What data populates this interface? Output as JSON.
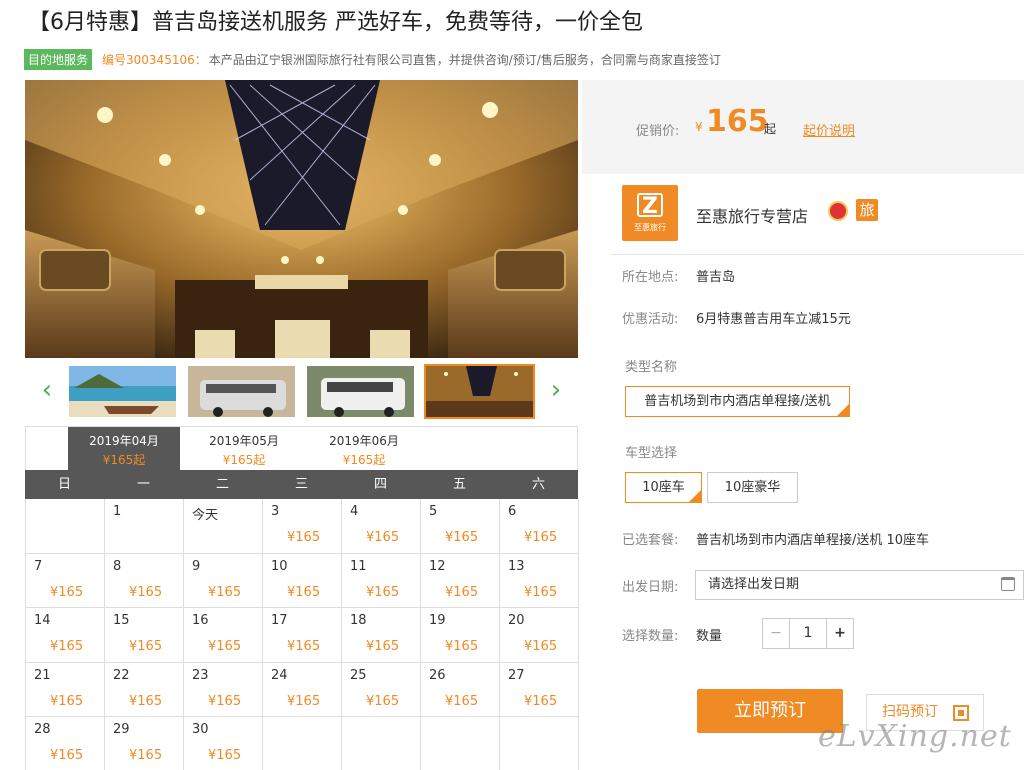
{
  "title": "【6月特惠】普吉岛接送机服务 严选好车，免费等待，一价全包",
  "meta": {
    "tag": "目的地服务",
    "code": "编号300345106：",
    "desc": "本产品由辽宁银洲国际旅行社有限公司直售，并提供咨询/预订/售后服务，合同需与商家直接签订"
  },
  "gallery": {
    "prev_icon": "chevron-left-icon",
    "next_icon": "chevron-right-icon",
    "active_thumb": 3
  },
  "months": [
    {
      "name": "2019年04月",
      "price": "¥165起"
    },
    {
      "name": "2019年05月",
      "price": "¥165起"
    },
    {
      "name": "2019年06月",
      "price": "¥165起"
    }
  ],
  "weekdays": [
    "日",
    "一",
    "二",
    "三",
    "四",
    "五",
    "六"
  ],
  "calendar": [
    {
      "d": "",
      "p": ""
    },
    {
      "d": "1",
      "p": ""
    },
    {
      "d": "今天",
      "p": ""
    },
    {
      "d": "3",
      "p": "¥165"
    },
    {
      "d": "4",
      "p": "¥165"
    },
    {
      "d": "5",
      "p": "¥165"
    },
    {
      "d": "6",
      "p": "¥165"
    },
    {
      "d": "7",
      "p": "¥165"
    },
    {
      "d": "8",
      "p": "¥165"
    },
    {
      "d": "9",
      "p": "¥165"
    },
    {
      "d": "10",
      "p": "¥165"
    },
    {
      "d": "11",
      "p": "¥165"
    },
    {
      "d": "12",
      "p": "¥165"
    },
    {
      "d": "13",
      "p": "¥165"
    },
    {
      "d": "14",
      "p": "¥165"
    },
    {
      "d": "15",
      "p": "¥165"
    },
    {
      "d": "16",
      "p": "¥165"
    },
    {
      "d": "17",
      "p": "¥165"
    },
    {
      "d": "18",
      "p": "¥165"
    },
    {
      "d": "19",
      "p": "¥165"
    },
    {
      "d": "20",
      "p": "¥165"
    },
    {
      "d": "21",
      "p": "¥165"
    },
    {
      "d": "22",
      "p": "¥165"
    },
    {
      "d": "23",
      "p": "¥165"
    },
    {
      "d": "24",
      "p": "¥165"
    },
    {
      "d": "25",
      "p": "¥165"
    },
    {
      "d": "26",
      "p": "¥165"
    },
    {
      "d": "27",
      "p": "¥165"
    },
    {
      "d": "28",
      "p": "¥165"
    },
    {
      "d": "29",
      "p": "¥165"
    },
    {
      "d": "30",
      "p": "¥165"
    },
    {
      "d": "",
      "p": ""
    },
    {
      "d": "",
      "p": ""
    },
    {
      "d": "",
      "p": ""
    },
    {
      "d": "",
      "p": ""
    }
  ],
  "price": {
    "label": "促销价:",
    "currency": "¥",
    "amount": "165",
    "suffix": "起",
    "explain": "起价说明"
  },
  "shop": {
    "logo_text": "至惠旅行",
    "name": "至惠旅行专营店",
    "badge_icon": "certified-badge-icon",
    "level": "旅"
  },
  "details": {
    "location_label": "所在地点:",
    "location_value": "普吉岛",
    "promo_label": "优惠活动:",
    "promo_value": "6月特惠普吉用车立减15元",
    "type_label": "类型名称",
    "type_option": "普吉机场到市内酒店单程接/送机",
    "car_label": "车型选择",
    "car_options": [
      "10座车",
      "10座豪华"
    ],
    "selected_label": "已选套餐:",
    "selected_value": "普吉机场到市内酒店单程接/送机 10座车",
    "date_label": "出发日期:",
    "date_placeholder": "请选择出发日期",
    "qty_label": "选择数量:",
    "qty_sub": "数量",
    "qty_value": "1",
    "minus": "−",
    "plus": "+"
  },
  "actions": {
    "book": "立即预订",
    "scan": "扫码预订"
  },
  "watermark": "eLvXing.net",
  "colors": {
    "accent": "#f08a24",
    "tag_green": "#5cb85c",
    "header_dark": "#575757"
  }
}
